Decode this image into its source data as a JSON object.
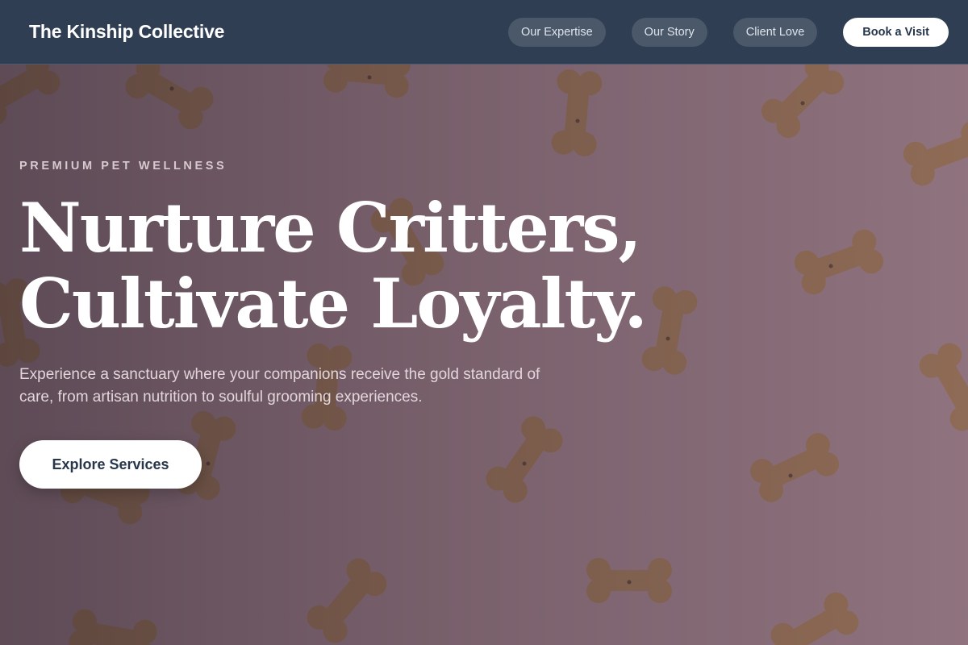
{
  "header": {
    "brand": "The Kinship Collective",
    "nav": [
      "Our Expertise",
      "Our Story",
      "Client Love"
    ],
    "cta": "Book a Visit"
  },
  "hero": {
    "eyebrow": "PREMIUM PET WELLNESS",
    "headline_line1": "Nurture Critters,",
    "headline_line2": "Cultivate Loyalty.",
    "subtext": "Experience a sanctuary where your companions receive the gold standard of care, from artisan nutrition to soulful grooming experiences.",
    "cta": "Explore Services"
  },
  "colors": {
    "header_bg": "#2f3e52",
    "nav_pill_bg": "#4a5869",
    "button_text": "#27364a",
    "background_surface": "#c9aab4",
    "treat_color": "#c89a5e"
  }
}
